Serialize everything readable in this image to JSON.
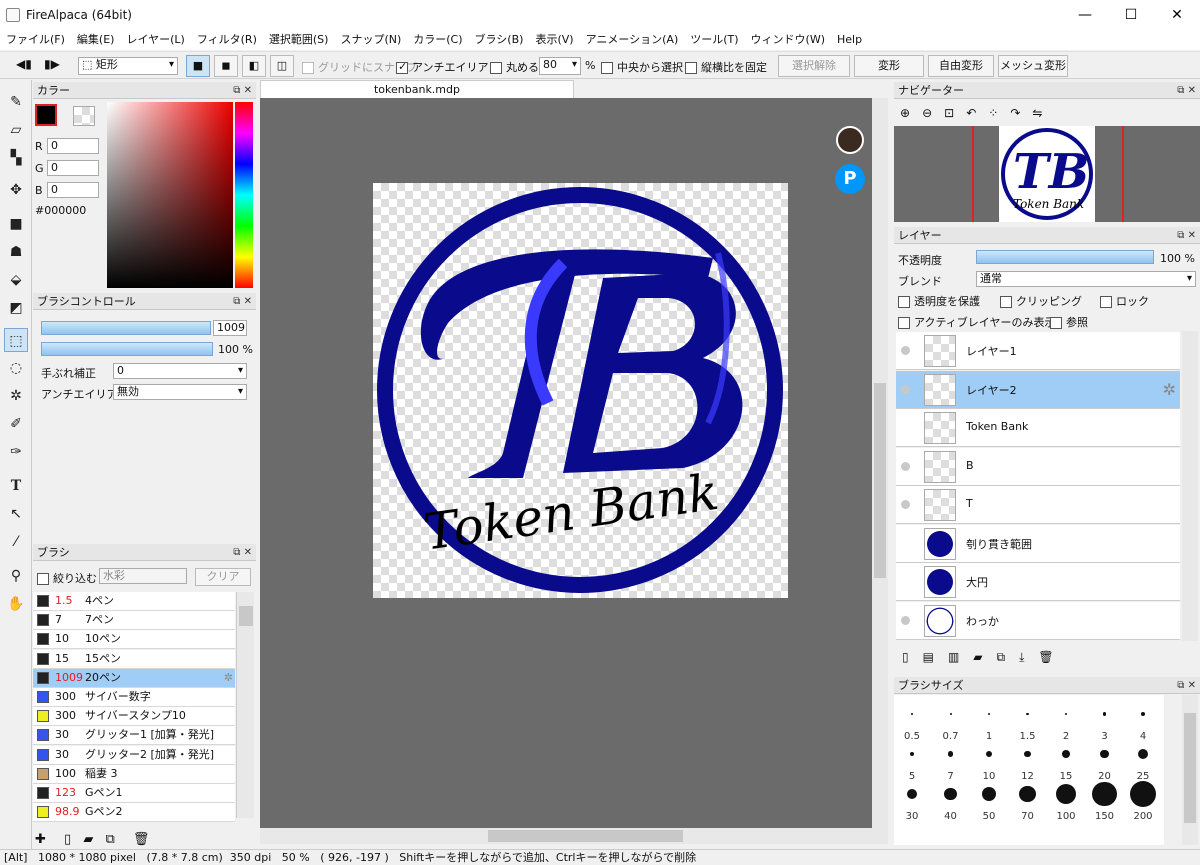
{
  "window": {
    "title": "FireAlpaca (64bit)",
    "min": "—",
    "max": "☐",
    "close": "✕"
  },
  "menu": [
    "ファイル(F)",
    "編集(E)",
    "レイヤー(L)",
    "フィルタ(R)",
    "選択範囲(S)",
    "スナップ(N)",
    "カラー(C)",
    "ブラシ(B)",
    "表示(V)",
    "アニメーション(A)",
    "ツール(T)",
    "ウィンドウ(W)",
    "Help"
  ],
  "toolbar": {
    "shape": "矩形",
    "grid_snap": "グリッドにスナップ",
    "antialias": "アンチエイリアス",
    "round": "丸める",
    "round_value": "80",
    "percent": "%",
    "from_center": "中央から選択",
    "fix_ratio": "縦横比を固定",
    "deselect": "選択解除",
    "transform": "変形",
    "free_transform": "自由変形",
    "mesh_transform": "メッシュ変形"
  },
  "color_panel": {
    "title": "カラー",
    "r_label": "R",
    "g_label": "G",
    "b_label": "B",
    "r": "0",
    "g": "0",
    "b": "0",
    "hex": "#000000"
  },
  "brush_control": {
    "title": "ブラシコントロール",
    "size": "1009",
    "opacity": "100 %",
    "stabilizer_label": "手ぶれ補正",
    "stabilizer": "0",
    "antialias_label": "アンチエイリアス",
    "antialias": "無効"
  },
  "brush_panel": {
    "title": "ブラシ",
    "filter_label": "絞り込む",
    "filter_placeholder": "水彩",
    "clear": "クリア",
    "items": [
      {
        "size": "1.5",
        "name": "4ペン",
        "color": "#222222",
        "red": true
      },
      {
        "size": "7",
        "name": "7ペン",
        "color": "#222222",
        "red": false
      },
      {
        "size": "10",
        "name": "10ペン",
        "color": "#222222",
        "red": false
      },
      {
        "size": "15",
        "name": "15ペン",
        "color": "#222222",
        "red": false
      },
      {
        "size": "1009",
        "name": "20ペン",
        "color": "#222222",
        "red": true
      },
      {
        "size": "300",
        "name": "サイバー数字",
        "color": "#3355ee",
        "red": false
      },
      {
        "size": "300",
        "name": "サイバースタンプ10",
        "color": "#eeee22",
        "red": false
      },
      {
        "size": "30",
        "name": "グリッター1 [加算・発光]",
        "color": "#3355ee",
        "red": false
      },
      {
        "size": "30",
        "name": "グリッター2 [加算・発光]",
        "color": "#3355ee",
        "red": false
      },
      {
        "size": "100",
        "name": "稲妻 3",
        "color": "#c8a070",
        "red": false
      },
      {
        "size": "123",
        "name": "Gペン1",
        "color": "#222222",
        "red": true
      },
      {
        "size": "98.9",
        "name": "Gペン2",
        "color": "#eeee22",
        "red": true
      }
    ]
  },
  "document": {
    "tab": "tokenbank.mdp",
    "logo_text": "Token Bank",
    "logo_letters": "TB"
  },
  "navigator": {
    "title": "ナビゲーター"
  },
  "layer_panel": {
    "title": "レイヤー",
    "opacity_label": "不透明度",
    "opacity": "100 %",
    "blend_label": "ブレンド",
    "blend": "通常",
    "protect_alpha": "透明度を保護",
    "clipping": "クリッピング",
    "lock": "ロック",
    "active_only": "アクティブレイヤーのみ表示",
    "reference": "参照",
    "layers": [
      {
        "name": "レイヤー1",
        "selected": false
      },
      {
        "name": "レイヤー2",
        "selected": true
      },
      {
        "name": "Token Bank",
        "selected": false
      },
      {
        "name": "B",
        "selected": false
      },
      {
        "name": "T",
        "selected": false
      },
      {
        "name": "刳り貫き範囲",
        "selected": false
      },
      {
        "name": "大円",
        "selected": false
      },
      {
        "name": "わっか",
        "selected": false
      }
    ]
  },
  "brush_size_panel": {
    "title": "ブラシサイズ",
    "sizes": [
      "0.5",
      "0.7",
      "1",
      "1.5",
      "2",
      "3",
      "4",
      "5",
      "7",
      "10",
      "12",
      "15",
      "20",
      "25",
      "30",
      "40",
      "50",
      "70",
      "100",
      "150",
      "200"
    ]
  },
  "status": {
    "text": "[Alt]   1080 * 1080 pixel   (7.8 * 7.8 cm)  350 dpi   50 %   ( 926, -197 )   Shiftキーを押しながらで追加、Ctrlキーを押しながらで削除"
  }
}
